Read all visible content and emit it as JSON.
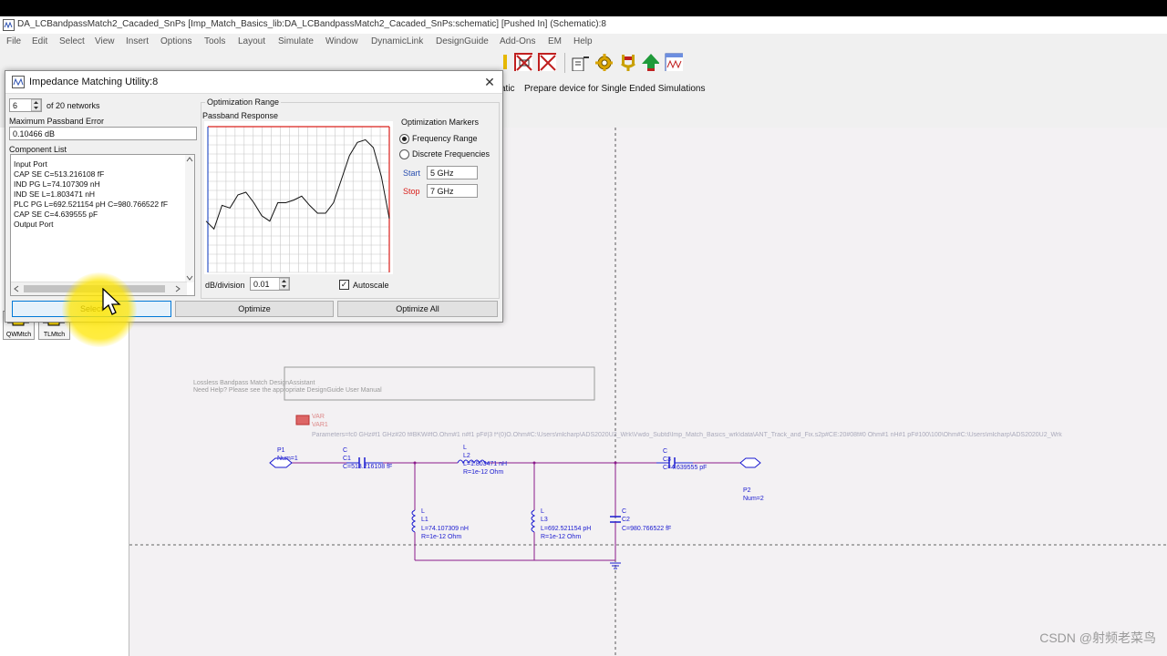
{
  "window": {
    "title": "DA_LCBandpassMatch2_Cacaded_SnPs [Imp_Match_Basics_lib:DA_LCBandpassMatch2_Cacaded_SnPs:schematic] [Pushed In] (Schematic):8"
  },
  "menu": [
    "File",
    "Edit",
    "Select",
    "View",
    "Insert",
    "Options",
    "Tools",
    "Layout",
    "Simulate",
    "Window",
    "DynamicLink",
    "DesignGuide",
    "Add-Ons",
    "EM",
    "Help"
  ],
  "toolbar2": {
    "partial_text": "atic",
    "prepare_text": "Prepare device for Single Ended Simulations"
  },
  "palette": {
    "items": [
      {
        "label": "QWMtch"
      },
      {
        "label": "TLMtch"
      }
    ]
  },
  "dialog": {
    "title": "Impedance Matching Utility:8",
    "network_index": "6",
    "of_networks": "of 20 networks",
    "max_error_label": "Maximum Passband Error",
    "max_error_value": "0.10466 dB",
    "component_list_label": "Component List",
    "components": [
      "Input Port",
      "CAP  SE  C=513.216108 fF",
      "IND  PG  L=74.107309 nH",
      "IND  SE  L=1.803471 nH",
      "PLC  PG  L=692.521154 pH  C=980.766522 fF",
      "CAP  SE  C=4.639555 pF",
      "Output Port"
    ],
    "optimization_range_label": "Optimization Range",
    "passband_label": "Passband Response",
    "markers_label": "Optimization Markers",
    "frequency_range_label": "Frequency Range",
    "discrete_label": "Discrete Frequencies",
    "start_label": "Start",
    "start_value": "5 GHz",
    "stop_label": "Stop",
    "stop_value": "7 GHz",
    "db_division_label": "dB/division",
    "db_division_value": "0.01",
    "autoscale_label": "Autoscale",
    "select_button": "Select",
    "optimize_button": "Optimize",
    "optimize_all_button": "Optimize All",
    "response_curve": [
      0.72,
      0.78,
      0.6,
      0.62,
      0.52,
      0.5,
      0.58,
      0.68,
      0.72,
      0.58,
      0.58,
      0.56,
      0.53,
      0.6,
      0.66,
      0.66,
      0.58,
      0.4,
      0.22,
      0.12,
      0.1,
      0.16,
      0.38,
      0.7
    ]
  },
  "schematic": {
    "note_line1": "Lossless Bandpass Match DesignAssistant",
    "note_line2": "Need Help?  Please see the appropriate DesignGuide User Manual",
    "var_label": "VAR",
    "var_name": "VAR1",
    "params_text": "Parameters=fc0 GHz#f1 GHz#20 f#BKW#fO.Ohm#1 n#f1 pF#|3 f*(0)O.Ohm#C:\\Users\\mlcharp\\ADS2020U2_Wrk\\Vwdo_Subtd\\Imp_Match_Basics_wrk\\data\\ANT_Track_and_Fix.s2p#CE:20#08f#0 Ohm#1 nH#1 pF#100\\100\\Ohm#C:\\Users\\mlcharp\\ADS2020U2_Wrk",
    "p1_name": "P1",
    "p1_num": "Num=1",
    "c1_type": "C",
    "c1_name": "C1",
    "c1_value": "C=513.216108 fF",
    "l2_type": "L",
    "l2_name": "L2",
    "l2_value": "L=1.803471 nH",
    "l2_r": "R=1e-12 Ohm",
    "c3_type": "C",
    "c3_name": "C3",
    "c3_value": "C=4.639555 pF",
    "p2_name": "P2",
    "p2_num": "Num=2",
    "l1_type": "L",
    "l1_name": "L1",
    "l1_value": "L=74.107309 nH",
    "l1_r": "R=1e-12 Ohm",
    "l3_type": "L",
    "l3_name": "L3",
    "l3_value": "L=692.521154 pH",
    "l3_r": "R=1e-12 Ohm",
    "c2_type": "C",
    "c2_name": "C2",
    "c2_value": "C=980.766522 fF"
  },
  "watermark": "CSDN @射频老菜鸟",
  "colors": {
    "wire": "#8b1a8b",
    "component": "#1a1ad0",
    "grid_red": "#d9201c",
    "grid_blue": "#2f55c8",
    "highlight": "#ffe600"
  }
}
